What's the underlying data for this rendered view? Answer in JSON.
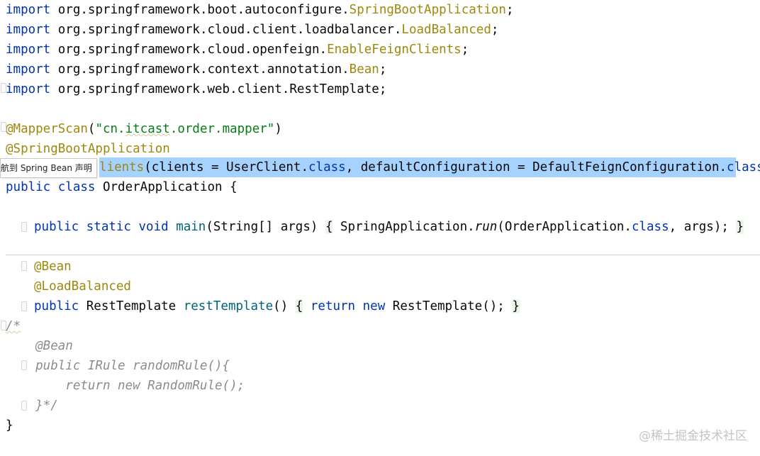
{
  "editor": {
    "imports": [
      {
        "kw": "import",
        "pkg": "org.springframework.boot.autoconfigure.",
        "cls": "SpringBootApplication",
        "semi": ";"
      },
      {
        "kw": "import",
        "pkg": "org.springframework.cloud.client.loadbalancer.",
        "cls": "LoadBalanced",
        "semi": ";"
      },
      {
        "kw": "import",
        "pkg": "org.springframework.cloud.openfeign.",
        "cls": "EnableFeignClients",
        "semi": ";"
      },
      {
        "kw": "import",
        "pkg": "org.springframework.context.annotation.",
        "cls": "Bean",
        "semi": ";"
      },
      {
        "kw": "import",
        "pkg": "org.springframework.web.client.RestTemplate",
        "cls": "",
        "semi": ";"
      }
    ],
    "mapper_scan": {
      "ann": "@MapperScan",
      "open": "(",
      "q1": "\"cn.",
      "itcast": "itcast",
      "q2": ".order.mapper\"",
      "close": ")"
    },
    "spring_boot_app": "@SpringBootApplication",
    "feign_line": {
      "fragment": "lients",
      "part1": "(clients = UserClient.",
      "kw1": "class",
      "part2": ", defaultConfiguration = DefaultFeignConfiguration.",
      "kw2": "class",
      "close": ")"
    },
    "class_decl": {
      "kw": "public class",
      "name": " OrderApplication {"
    },
    "main_method": {
      "mods": "public static void",
      "name": "main",
      "params": "(String[] args) ",
      "lbrace": "{",
      "body1": " SpringApplication.",
      "run": "run",
      "body2": "(OrderApplication.",
      "kw": "class",
      "body3": ", args); ",
      "rbrace": "}"
    },
    "bean_ann": "@Bean",
    "lb_ann": "@LoadBalanced",
    "rest_method": {
      "kw": "public",
      "type": " RestTemplate ",
      "name": "restTemplate",
      "params": "() ",
      "lbrace": "{",
      "ret": "return",
      "new_kw": "new",
      "body": " RestTemplate(); ",
      "rbrace": "}"
    },
    "comment_lines": [
      "/*",
      "    @Bean",
      "    public IRule randomRule(){",
      "        return new RandomRule();",
      "    }*/"
    ],
    "closing_brace": "}"
  },
  "tooltip": {
    "text": "航到 Spring Bean 声明"
  },
  "watermark": {
    "text": "@稀土掘金技术社区"
  }
}
